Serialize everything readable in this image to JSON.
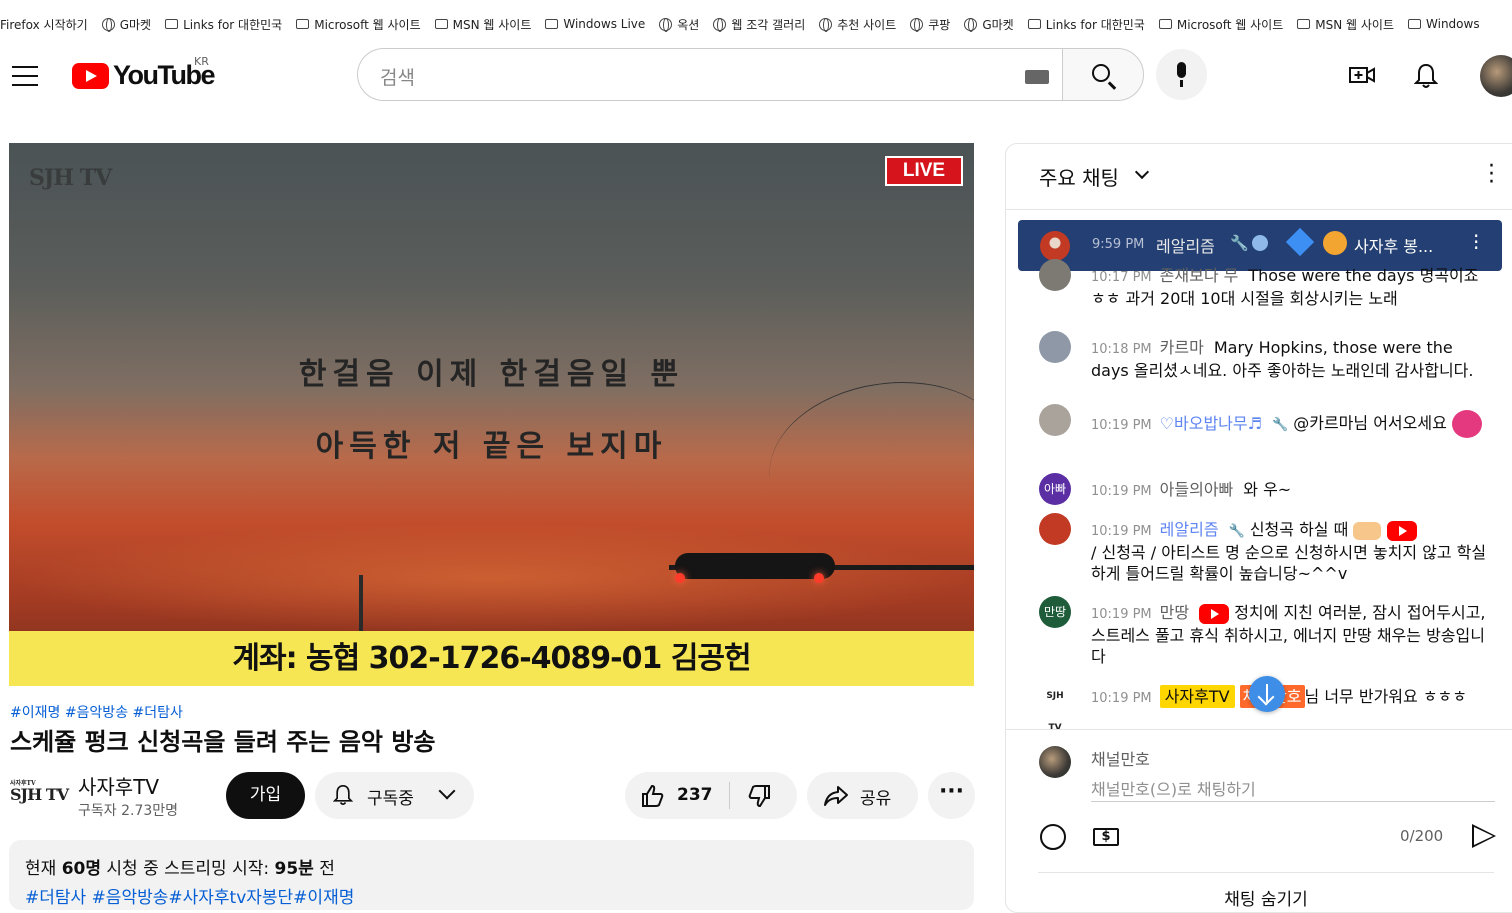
{
  "bookmarks": [
    {
      "label": "Firefox 시작하기",
      "icon": "firefox-icon"
    },
    {
      "label": "G마켓",
      "icon": "globe-icon"
    },
    {
      "label": "Links for 대한민국",
      "icon": "folder-icon"
    },
    {
      "label": "Microsoft 웹 사이트",
      "icon": "folder-icon"
    },
    {
      "label": "MSN 웹 사이트",
      "icon": "folder-icon"
    },
    {
      "label": "Windows Live",
      "icon": "folder-icon"
    },
    {
      "label": "옥션",
      "icon": "globe-icon"
    },
    {
      "label": "웹 조각 갤러리",
      "icon": "globe-icon"
    },
    {
      "label": "추천 사이트",
      "icon": "globe-icon"
    },
    {
      "label": "쿠팡",
      "icon": "globe-icon"
    },
    {
      "label": "G마켓",
      "icon": "globe-icon"
    },
    {
      "label": "Links for 대한민국",
      "icon": "folder-icon"
    },
    {
      "label": "Microsoft 웹 사이트",
      "icon": "folder-icon"
    },
    {
      "label": "MSN 웹 사이트",
      "icon": "folder-icon"
    },
    {
      "label": "Windows",
      "icon": "folder-icon"
    }
  ],
  "masthead": {
    "logo_text": "YouTube",
    "country_code": "KR",
    "search_placeholder": "검색"
  },
  "player": {
    "watermark": "SJH TV",
    "live_badge": "LIVE",
    "lyric_line1": "한걸음 이제 한걸음일 뿐",
    "lyric_line2": "아득한 저 끝은 보지마",
    "banner": "계좌: 농협 302-1726-4089-01 김공헌"
  },
  "video": {
    "hashtags": "#이재명 #음악방송 #더탐사",
    "title": "스케쥴 펑크 신청곡을 들려 주는 음악 방송",
    "channel_logo": "SJH TV",
    "channel_logo_small": "사자후TV",
    "channel_name": "사자후TV",
    "subscribers": "구독자 2.73만명",
    "join_label": "가입",
    "subscribed_label": "구독중",
    "like_count": "237",
    "share_label": "공유",
    "more_label": "···"
  },
  "description": {
    "prefix": "현재 ",
    "viewers": "60명",
    "mid": " 시청 중  스트리밍 시작: ",
    "started": "95분",
    "suffix": " 전",
    "tags": "#더탐사 #음악방송#사자후tv자봉단#이재명"
  },
  "chat": {
    "header": "주요 채팅",
    "pinned": {
      "time": "9:59 PM",
      "author": "레알리즘",
      "text": "사자후 봉..."
    },
    "messages": [
      {
        "time": "10:17 PM",
        "author": "존재보다 무",
        "text": "Those were the days 명곡이죠 ㅎㅎ 과거 20대 10대 시절을 회상시키는 노래",
        "avatar_color": "#7d7a74"
      },
      {
        "time": "10:18 PM",
        "author": "카르마",
        "text": "Mary Hopkins, those were the days 올리셨ㅅ네요. 아주 좋아하는 노래인데 감사합니다.",
        "avatar_color": "#8e98a6"
      },
      {
        "time": "10:19 PM",
        "author": "♡바오밥나무♬",
        "text": "@카르마님 어서오세요",
        "avatar_color": "#a9a39b"
      },
      {
        "time": "10:19 PM",
        "author": "아들의아빠",
        "text": "와 우~",
        "avatar_text": "아빠",
        "avatar_color": "#5b2fa3"
      },
      {
        "time": "10:19 PM",
        "author": "레알리즘",
        "text": "신청곡 하실 때",
        "text2": "/ 신청곡 / 아티스트 명 순으로 신청하시면 놓치지 않고 학실하게 틀어드릴 확률이 높습니당~^^v",
        "avatar_color": "#c23a24"
      },
      {
        "time": "10:19 PM",
        "author": "만땅",
        "text": "정치에 지친 여러분, 잠시 접어두시고, 스트레스 풀고 휴식 취하시고, 에너지 만땅 채우는 방송입니다",
        "avatar_text": "만땅",
        "avatar_color": "#1e5c3a"
      },
      {
        "time": "10:19 PM",
        "author": "사자후TV",
        "mention": "채널만호",
        "text": "님 너무 반가워요 ㅎㅎㅎ",
        "avatar_text": "SJH TV"
      }
    ],
    "user_name": "채널만호",
    "input_placeholder": "채널만호(으)로 채팅하기",
    "char_count": "0/200",
    "hide_label": "채팅 숨기기"
  },
  "colors": {
    "accent": "#ff0000",
    "link": "#065fd4",
    "pinned_bg": "#233f73",
    "owner_badge": "#ffd600"
  }
}
